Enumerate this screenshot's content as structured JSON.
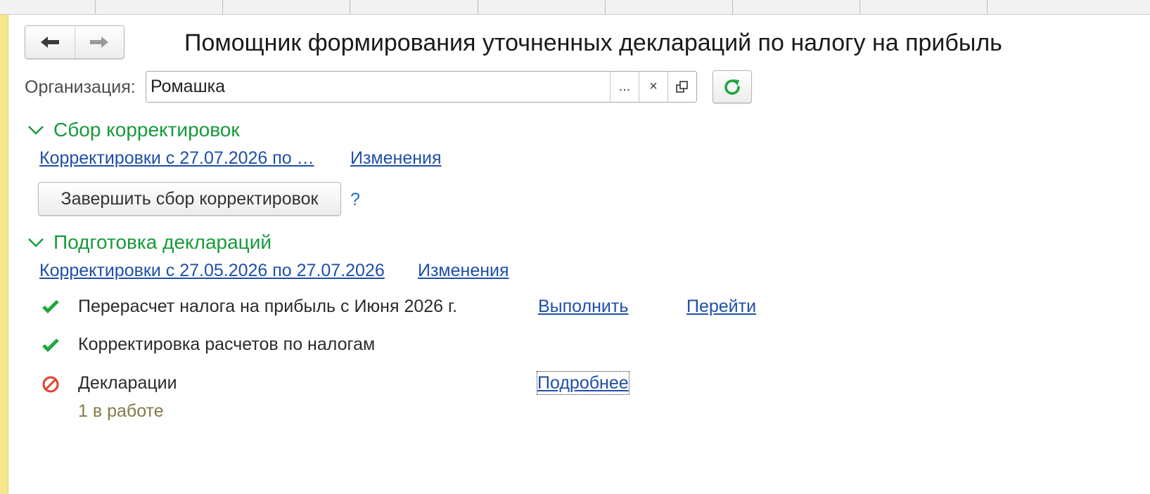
{
  "window": {
    "title": "Помощник формирования уточненных деклараций по налогу на прибыль"
  },
  "nav": {
    "back_icon": "arrow-left-icon",
    "forward_icon": "arrow-right-icon"
  },
  "organization": {
    "label": "Организация:",
    "value": "Ромашка",
    "select_label": "...",
    "clear_label": "×",
    "open_icon": "open-in-window-icon",
    "refresh_icon": "refresh-icon"
  },
  "section_collect": {
    "title": "Сбор корректировок",
    "period_link": "Корректировки с 27.07.2026 по …",
    "changes_link": "Изменения",
    "finish_button": "Завершить сбор корректировок",
    "help_label": "?"
  },
  "section_prepare": {
    "title": "Подготовка деклараций",
    "period_link": "Корректировки с 27.05.2026 по 27.07.2026",
    "changes_link": "Изменения",
    "tasks": [
      {
        "text": "Перерасчет налога на прибыль с Июня 2026 г.",
        "status": "done",
        "action1": "Выполнить",
        "action2": "Перейти"
      },
      {
        "text": "Корректировка расчетов по налогам",
        "status": "done"
      },
      {
        "text": "Декларации",
        "status": "blocked",
        "action1": "Подробнее",
        "sub": "1 в работе"
      }
    ]
  },
  "colors": {
    "accent_green": "#169a3b",
    "link_blue": "#1f4fa8",
    "error_red": "#e0412f",
    "stripe_yellow": "#f7e58a"
  }
}
